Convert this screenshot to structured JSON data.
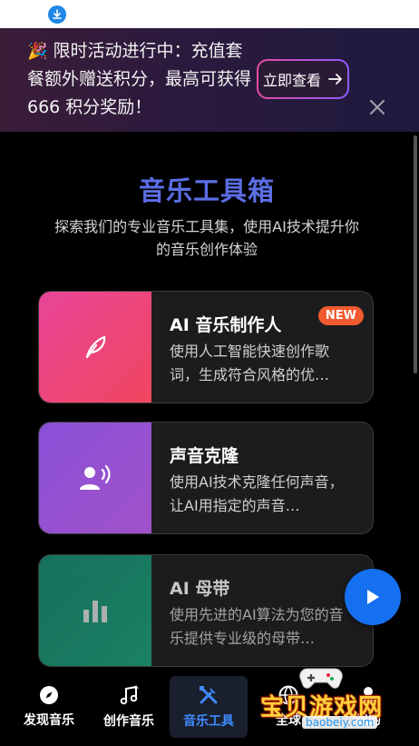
{
  "status_bar": {
    "download_icon": "download-icon"
  },
  "banner": {
    "emoji": "🎉",
    "text": "限时活动进行中：充值套餐额外赠送积分，最高可获得 666 积分奖励！",
    "cta_label": "立即查看",
    "cta_icon": "arrow-right-icon",
    "close_icon": "close-icon"
  },
  "page": {
    "title": "音乐工具箱",
    "subtitle": "探索我们的专业音乐工具集，使用AI技术提升你的音乐创作体验"
  },
  "tools": [
    {
      "title": "AI 音乐制作人",
      "description": "使用人工智能快速创作歌词，生成符合风格的优…",
      "badge": "NEW",
      "icon": "feather-icon",
      "color": "#e94a7c"
    },
    {
      "title": "声音克隆",
      "description": "使用AI技术克隆任何声音，让AI用指定的声音…",
      "icon": "voice-user-icon",
      "color": "#8b55d6"
    },
    {
      "title": "AI 母带",
      "description": "使用先进的AI算法为您的音乐提供专业级的母带…",
      "icon": "bar-chart-icon",
      "color": "#1a8a6e"
    }
  ],
  "play_button_icon": "play-icon",
  "nav": [
    {
      "label": "发现音乐",
      "icon": "compass-icon",
      "active": false
    },
    {
      "label": "创作音乐",
      "icon": "music-note-icon",
      "active": false
    },
    {
      "label": "音乐工具",
      "icon": "tools-icon",
      "active": true
    },
    {
      "label": "全球",
      "icon": "globe-icon",
      "active": false
    },
    {
      "label": "我的",
      "icon": "user-icon",
      "active": false
    }
  ],
  "watermark": {
    "title": "宝贝游戏网",
    "url": "baobeiy.com"
  }
}
